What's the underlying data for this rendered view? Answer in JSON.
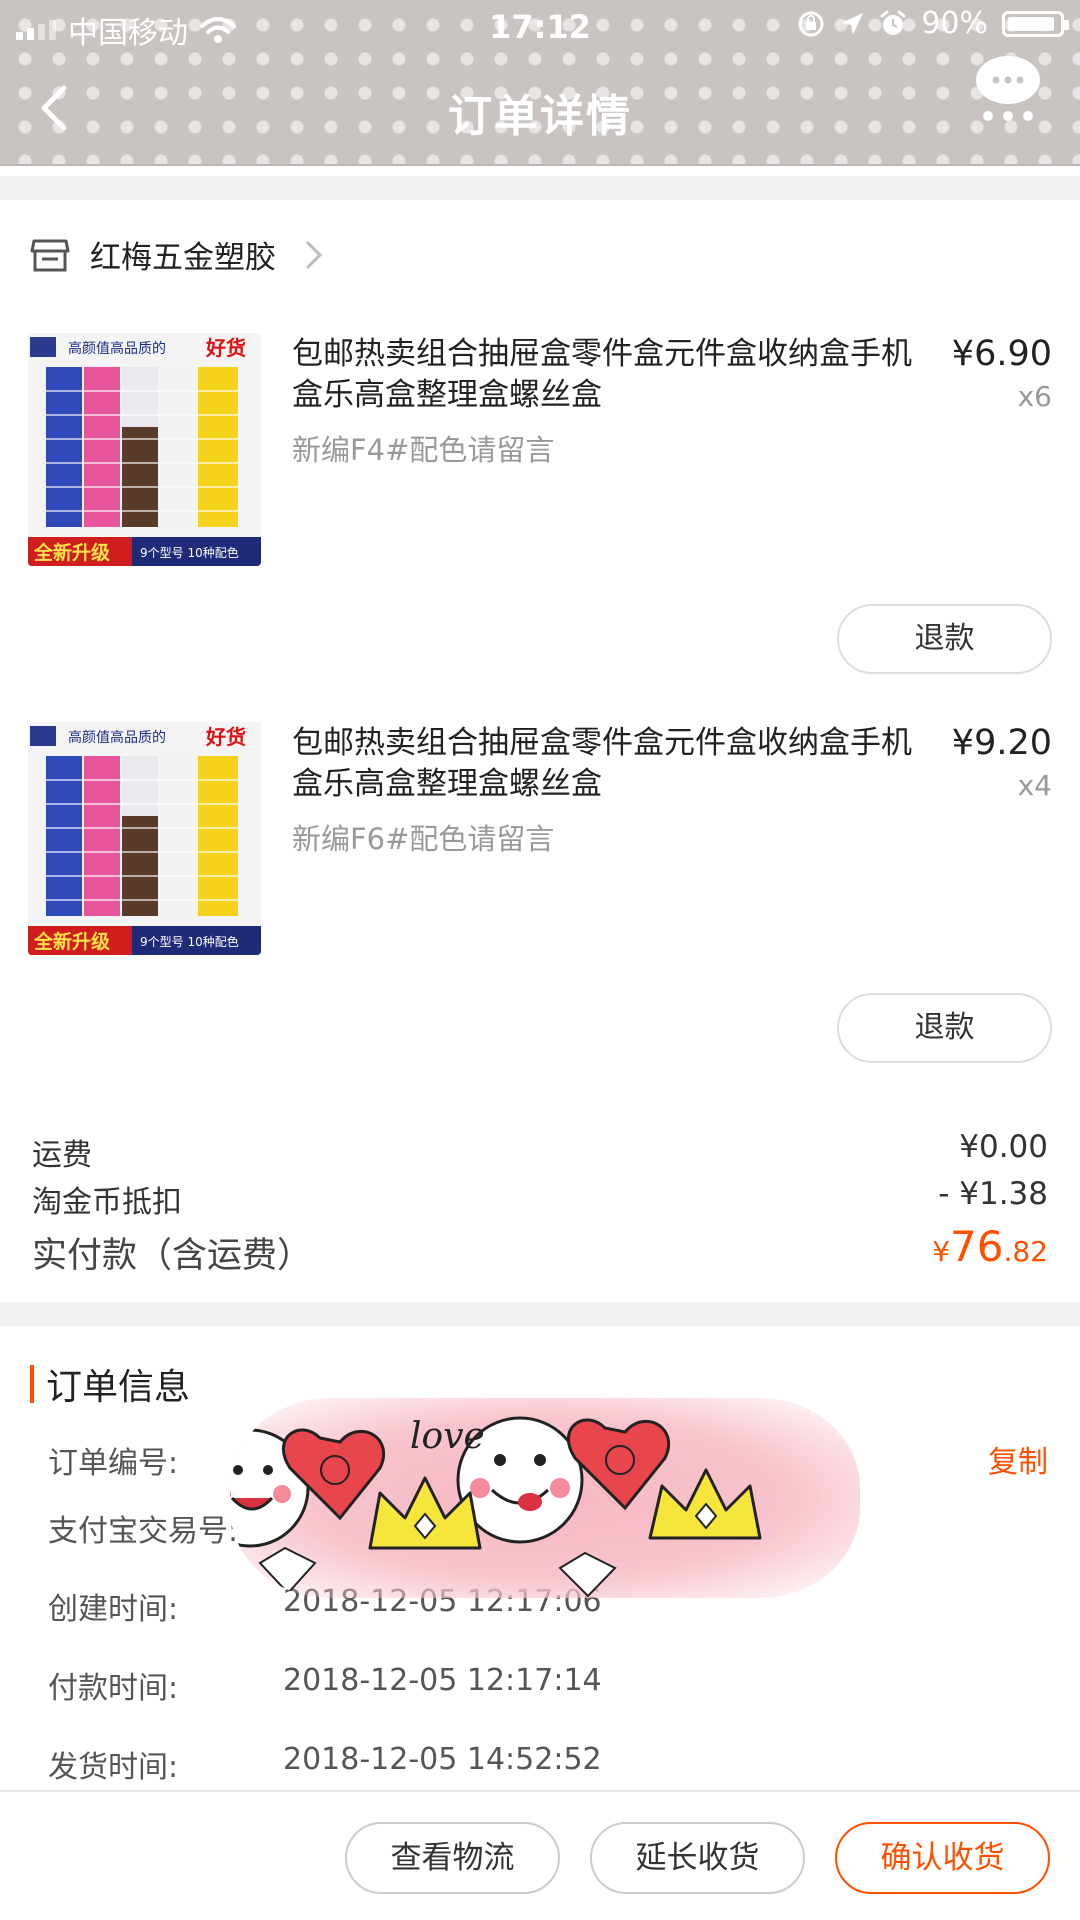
{
  "status_bar": {
    "carrier": "中国移动",
    "time": "17:12",
    "battery": "90%"
  },
  "nav": {
    "title": "订单详情"
  },
  "shop": {
    "name": "红梅五金塑胶"
  },
  "items": [
    {
      "title": "包邮热卖组合抽屉盒零件盒元件盒收纳盒手机盒乐高盒整理盒螺丝盒",
      "spec": "新编F4#配色请留言",
      "price": "¥6.90",
      "qty": "x6",
      "refund_label": "退款",
      "image_banner": "高颜值高品质的",
      "image_badge": "好货",
      "image_bottom_left": "全新升级",
      "image_bottom_right": "9个型号 10种配色"
    },
    {
      "title": "包邮热卖组合抽屉盒零件盒元件盒收纳盒手机盒乐高盒整理盒螺丝盒",
      "spec": "新编F6#配色请留言",
      "price": "¥9.20",
      "qty": "x4",
      "refund_label": "退款",
      "image_banner": "高颜值高品质的",
      "image_badge": "好货",
      "image_bottom_left": "全新升级",
      "image_bottom_right": "9个型号 10种配色"
    }
  ],
  "summary": {
    "shipping_label": "运费",
    "shipping_value": "¥0.00",
    "coin_label": "淘金币抵扣",
    "coin_value": "- ¥1.38",
    "total_label": "实付款（含运费）",
    "total_currency": "¥",
    "total_int": "76",
    "total_dec": ".82"
  },
  "order_info": {
    "heading": "订单信息",
    "order_no_label": "订单编号:",
    "alipay_no_label": "支付宝交易号:",
    "copy_label": "复制",
    "created_label": "创建时间:",
    "created_value": "2018-12-05 12:17:06",
    "paid_label": "付款时间:",
    "paid_value": "2018-12-05 12:17:14",
    "shipped_label": "发货时间:",
    "shipped_value": "2018-12-05 14:52:52",
    "sticker_text": "love"
  },
  "bottom_actions": {
    "logistics": "查看物流",
    "extend": "延长收货",
    "confirm": "确认收货"
  },
  "colors": {
    "accent": "#ff5000",
    "header_bg": "#c9c4c1"
  }
}
